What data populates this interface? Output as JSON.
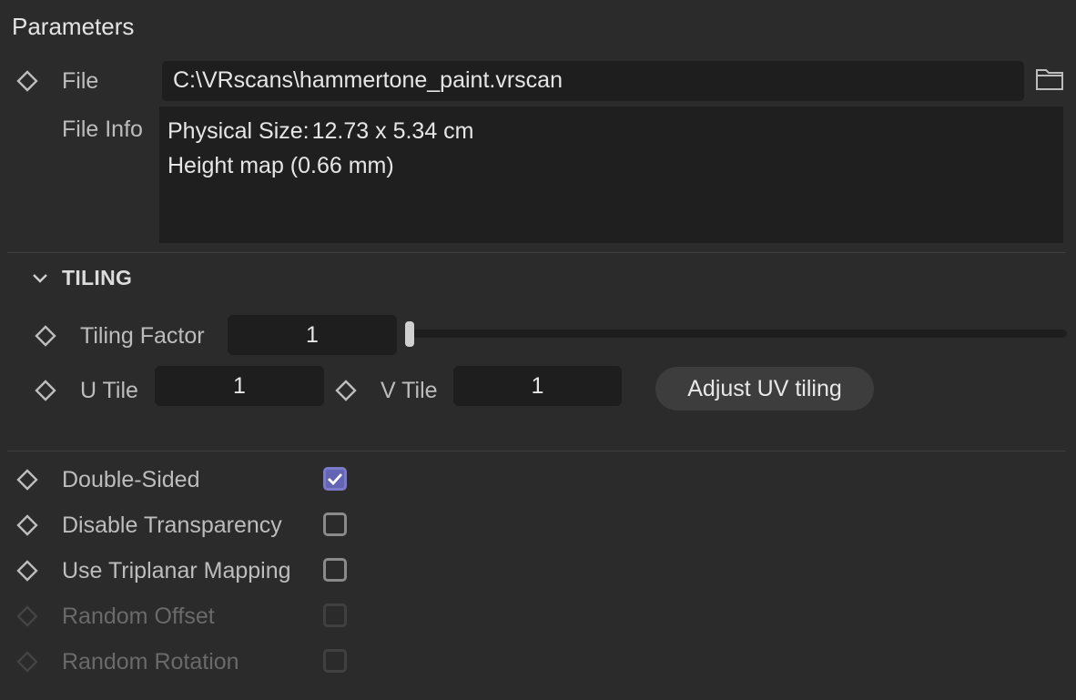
{
  "panel": {
    "title": "Parameters"
  },
  "file": {
    "label": "File",
    "value": "C:\\VRscans\\hammertone_paint.vrscan",
    "icon": "folder-icon"
  },
  "file_info": {
    "label": "File Info",
    "physical_size_key": "Physical Size:",
    "physical_size_value": "12.73 x 5.34 cm",
    "height_map": "Height map (0.66 mm)"
  },
  "tiling": {
    "section_title": "TILING",
    "tiling_factor_label": "Tiling Factor",
    "tiling_factor_value": "1",
    "slider_fraction": 0.0,
    "u_tile_label": "U Tile",
    "u_tile_value": "1",
    "v_tile_label": "V Tile",
    "v_tile_value": "1",
    "adjust_button": "Adjust UV tiling"
  },
  "options": [
    {
      "label": "Double-Sided",
      "checked": true,
      "enabled": true
    },
    {
      "label": "Disable Transparency",
      "checked": false,
      "enabled": true
    },
    {
      "label": "Use Triplanar Mapping",
      "checked": false,
      "enabled": true
    },
    {
      "label": "Random Offset",
      "checked": false,
      "enabled": false
    },
    {
      "label": "Random Rotation",
      "checked": false,
      "enabled": false
    }
  ],
  "colors": {
    "background": "#2b2b2b",
    "field": "#1e1e1e",
    "checkbox_accent": "#6464b4"
  }
}
